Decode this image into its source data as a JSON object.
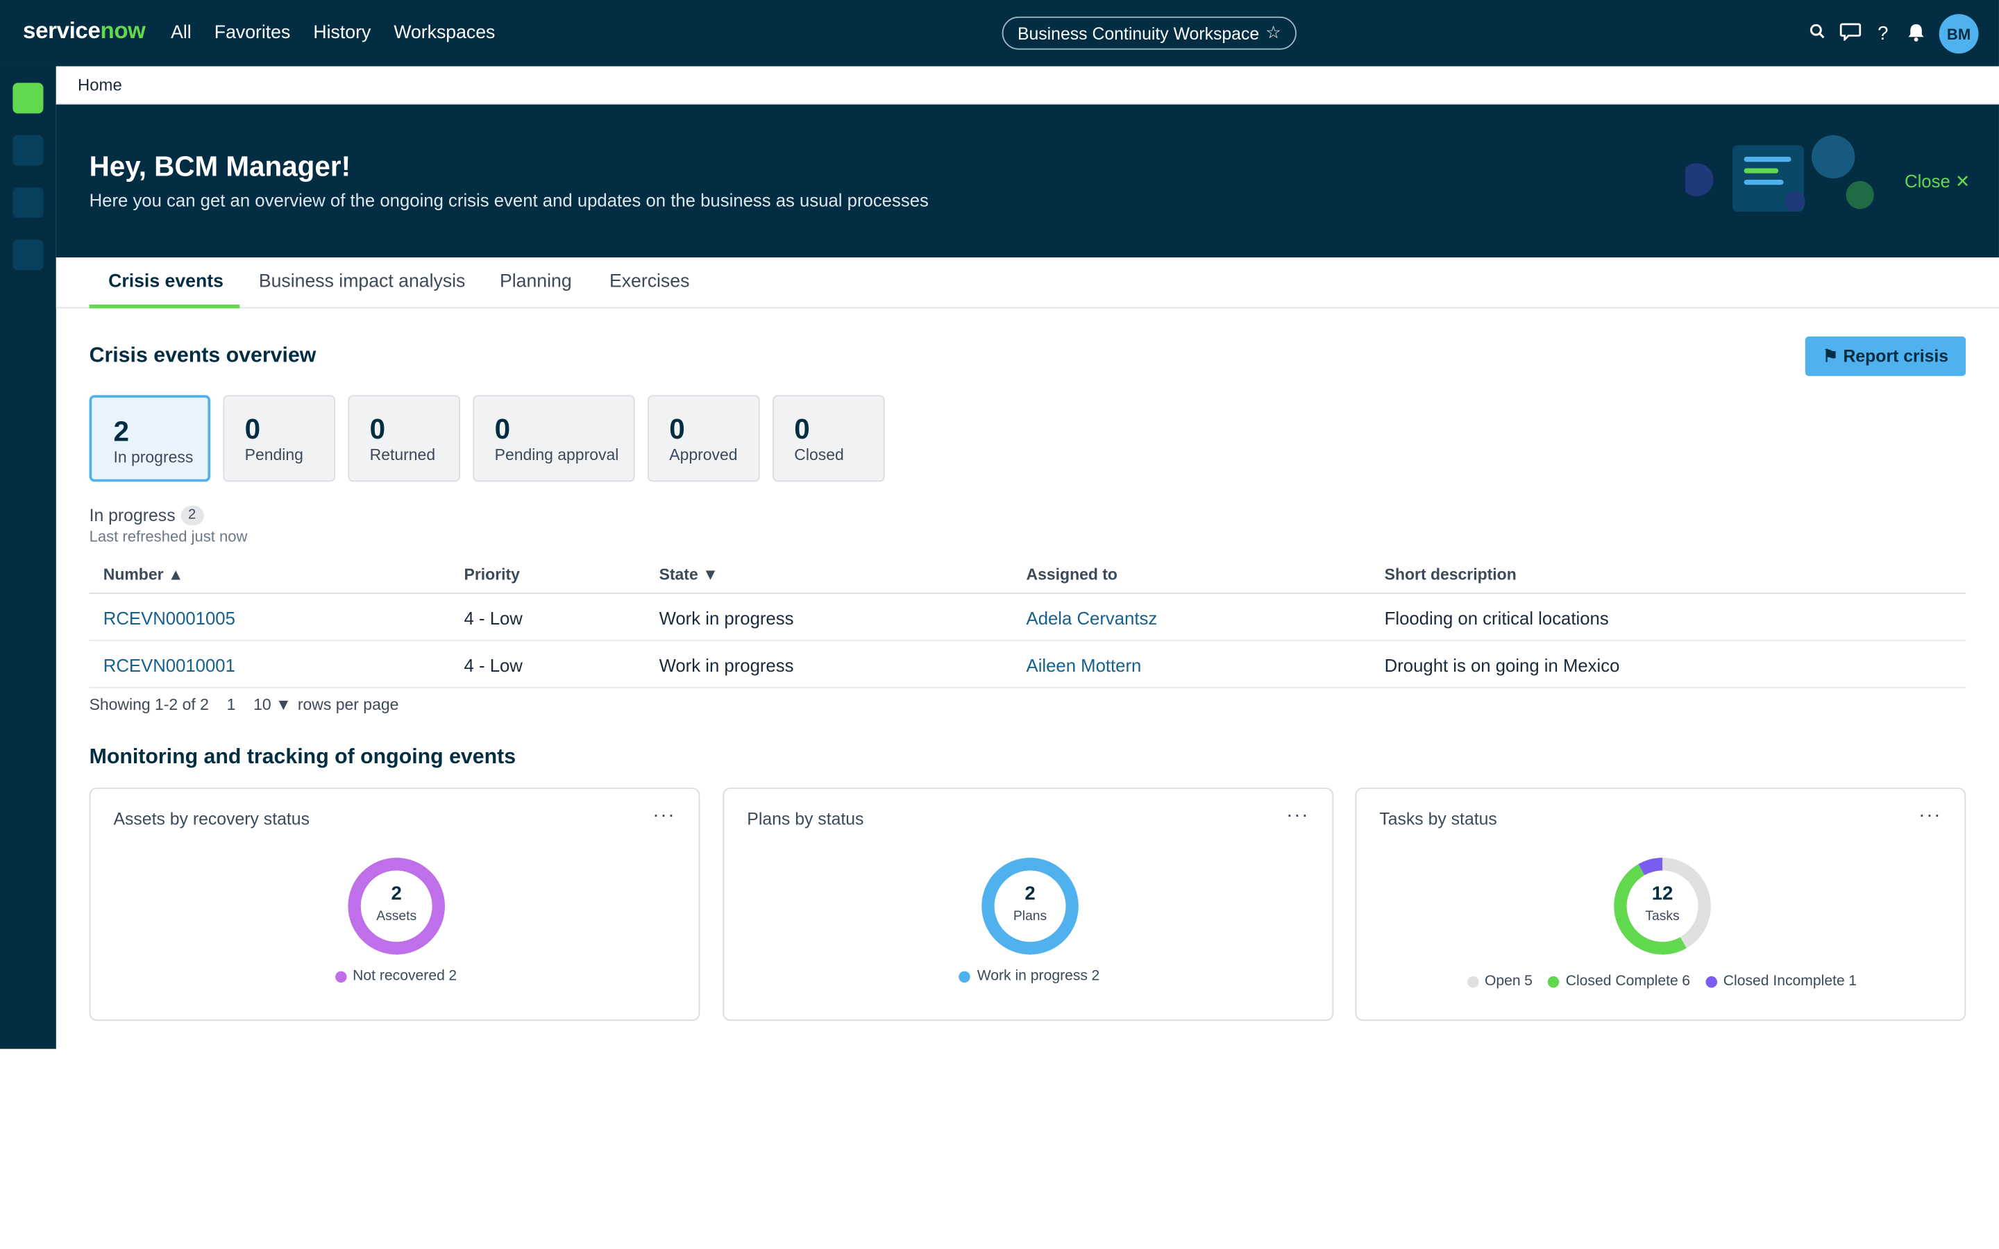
{
  "app": {
    "logo_service": "service",
    "logo_now": "now",
    "nav": [
      "All",
      "Favorites",
      "History",
      "Workspaces"
    ],
    "workspace": "Business Continuity Workspace",
    "workspace_star": "☆",
    "avatar_initials": "BM",
    "icons": [
      "search-icon",
      "chat-icon",
      "help-icon",
      "bell-icon"
    ]
  },
  "breadcrumb": "Home",
  "hero": {
    "title": "Hey, BCM Manager!",
    "subtitle": "Here you can get an overview of the ongoing crisis event and updates on the business as usual processes",
    "close_label": "Close ✕"
  },
  "tabs": [
    "Crisis events",
    "Business impact analysis",
    "Planning",
    "Exercises"
  ],
  "overview": {
    "title": "Crisis events overview",
    "report_button": "Report crisis",
    "stats": [
      {
        "value": "2",
        "label": "In progress"
      },
      {
        "value": "0",
        "label": "Pending"
      },
      {
        "value": "0",
        "label": "Returned"
      },
      {
        "value": "0",
        "label": "Pending approval"
      },
      {
        "value": "0",
        "label": "Approved"
      },
      {
        "value": "0",
        "label": "Closed"
      }
    ]
  },
  "list": {
    "heading": "In progress",
    "count": "2",
    "refreshed": "Last refreshed just now",
    "columns": [
      "Number ▲",
      "Priority",
      "State ▼",
      "Assigned to",
      "Short description"
    ],
    "rows": [
      {
        "number": "RCEVN0001005",
        "priority": "4 - Low",
        "state": "Work in progress",
        "assigned": "Adela Cervantsz",
        "description": "Flooding on critical locations"
      },
      {
        "number": "RCEVN0010001",
        "priority": "4 - Low",
        "state": "Work in progress",
        "assigned": "Aileen Mottern",
        "description": "Drought is on going in Mexico"
      }
    ],
    "showing": "Showing 1-2 of 2",
    "page": "1",
    "rows_per_page": "10 ▼",
    "rows_per_page_label": "rows per page"
  },
  "monitoring": {
    "title": "Monitoring and tracking of ongoing events",
    "more": "···",
    "cards": [
      {
        "title": "Assets by recovery status",
        "total": "2",
        "unit": "Assets",
        "segments": [
          {
            "label": "Not recovered",
            "value": 2,
            "color": "#bf6fea"
          }
        ]
      },
      {
        "title": "Plans by status",
        "total": "2",
        "unit": "Plans",
        "segments": [
          {
            "label": "Work in progress",
            "value": 2,
            "color": "#4fb1ee"
          }
        ]
      },
      {
        "title": "Tasks by status",
        "total": "12",
        "unit": "Tasks",
        "segments": [
          {
            "label": "Open",
            "value": 5,
            "color": "#e0e0e0"
          },
          {
            "label": "Closed Complete",
            "value": 6,
            "color": "#62d84e"
          },
          {
            "label": "Closed Incomplete",
            "value": 1,
            "color": "#7a5cf0"
          }
        ]
      }
    ]
  },
  "colors": {
    "nav_bg": "#032d42",
    "accent_green": "#62d84e",
    "accent_blue": "#4fb1ee",
    "link": "#16608e"
  }
}
